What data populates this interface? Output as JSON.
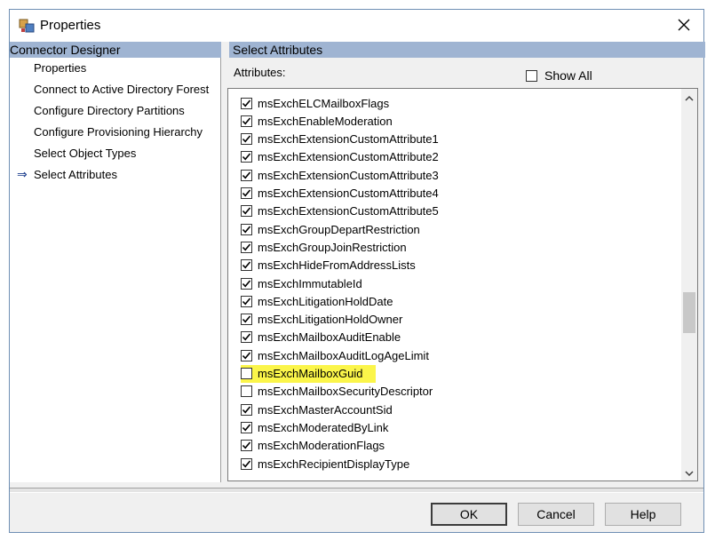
{
  "window": {
    "title": "Properties",
    "icons": {
      "app": "properties-icon",
      "close": "close-icon"
    }
  },
  "left_panel": {
    "header": "Connector Designer",
    "items": [
      {
        "label": "Properties",
        "current": false
      },
      {
        "label": "Connect to Active Directory Forest",
        "current": false
      },
      {
        "label": "Configure Directory Partitions",
        "current": false
      },
      {
        "label": "Configure Provisioning Hierarchy",
        "current": false
      },
      {
        "label": "Select Object Types",
        "current": false
      },
      {
        "label": "Select Attributes",
        "current": true
      }
    ]
  },
  "right_panel": {
    "header": "Select Attributes",
    "attributes_label": "Attributes:",
    "show_all": {
      "label": "Show All",
      "checked": false
    },
    "attributes": [
      {
        "name": "msExchELCMailboxFlags",
        "checked": true
      },
      {
        "name": "msExchEnableModeration",
        "checked": true
      },
      {
        "name": "msExchExtensionCustomAttribute1",
        "checked": true
      },
      {
        "name": "msExchExtensionCustomAttribute2",
        "checked": true
      },
      {
        "name": "msExchExtensionCustomAttribute3",
        "checked": true
      },
      {
        "name": "msExchExtensionCustomAttribute4",
        "checked": true
      },
      {
        "name": "msExchExtensionCustomAttribute5",
        "checked": true
      },
      {
        "name": "msExchGroupDepartRestriction",
        "checked": true
      },
      {
        "name": "msExchGroupJoinRestriction",
        "checked": true
      },
      {
        "name": "msExchHideFromAddressLists",
        "checked": true
      },
      {
        "name": "msExchImmutableId",
        "checked": true
      },
      {
        "name": "msExchLitigationHoldDate",
        "checked": true
      },
      {
        "name": "msExchLitigationHoldOwner",
        "checked": true
      },
      {
        "name": "msExchMailboxAuditEnable",
        "checked": true
      },
      {
        "name": "msExchMailboxAuditLogAgeLimit",
        "checked": true
      },
      {
        "name": "msExchMailboxGuid",
        "checked": false,
        "highlighted": true
      },
      {
        "name": "msExchMailboxSecurityDescriptor",
        "checked": false
      },
      {
        "name": "msExchMasterAccountSid",
        "checked": true
      },
      {
        "name": "msExchModeratedByLink",
        "checked": true
      },
      {
        "name": "msExchModerationFlags",
        "checked": true
      },
      {
        "name": "msExchRecipientDisplayType",
        "checked": true
      }
    ],
    "highlight_color": "#fbf54a"
  },
  "buttons": {
    "ok": "OK",
    "cancel": "Cancel",
    "help": "Help"
  }
}
